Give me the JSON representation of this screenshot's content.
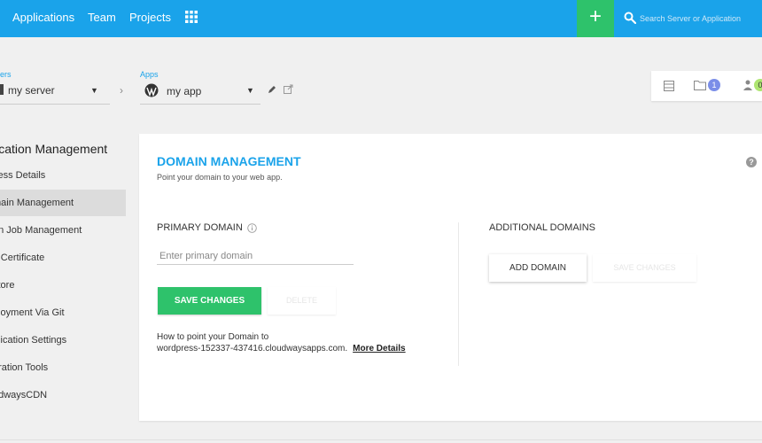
{
  "topnav": {
    "links": [
      "Applications",
      "Team",
      "Projects"
    ],
    "grid_icon": "apps-grid-icon",
    "plus_label": "+",
    "search_placeholder": "Search Server or Application"
  },
  "breadcrumb": {
    "servers_label": "ers",
    "server_name": "my server",
    "separator": "›",
    "apps_label": "Apps",
    "app_name": "my app"
  },
  "icon_panel": {
    "folder_count": "1",
    "user_count": "0"
  },
  "sidebar": {
    "title": "lication Management",
    "items": [
      "cess Details",
      "main Management",
      "on Job Management",
      "L Certificate",
      "store",
      "ployment Via Git",
      "plication Settings",
      "gration Tools",
      "udwaysCDN"
    ],
    "active_index": 1
  },
  "main": {
    "title": "DOMAIN MANAGEMENT",
    "subtitle": "Point your domain to your web app.",
    "primary_label": "PRIMARY DOMAIN",
    "primary_placeholder": "Enter primary domain",
    "save_label": "SAVE CHANGES",
    "delete_label": "DELETE",
    "howto_line1": "How to point your Domain to",
    "howto_line2": "wordpress-152337-437416.cloudwaysapps.com.",
    "more_details": "More Details",
    "additional_label": "ADDITIONAL DOMAINS",
    "add_domain_label": "ADD DOMAIN",
    "save2_label": "SAVE CHANGES"
  },
  "colors": {
    "brand": "#1aa3ea",
    "success": "#2ec26b"
  }
}
